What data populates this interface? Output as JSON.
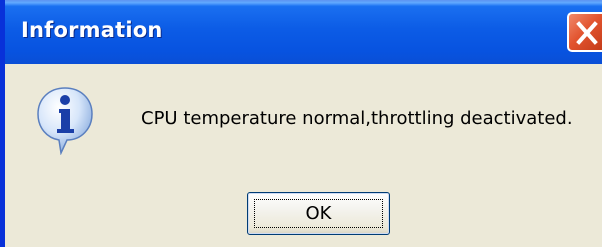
{
  "window": {
    "title": "Information",
    "close_icon": "close-icon"
  },
  "dialog": {
    "icon": "information-icon",
    "message": "CPU temperature normal,throttling deactivated.",
    "ok_label": "OK"
  },
  "colors": {
    "titlebar": "#0853e0",
    "body": "#ece9d8",
    "close_button": "#e2542f"
  }
}
